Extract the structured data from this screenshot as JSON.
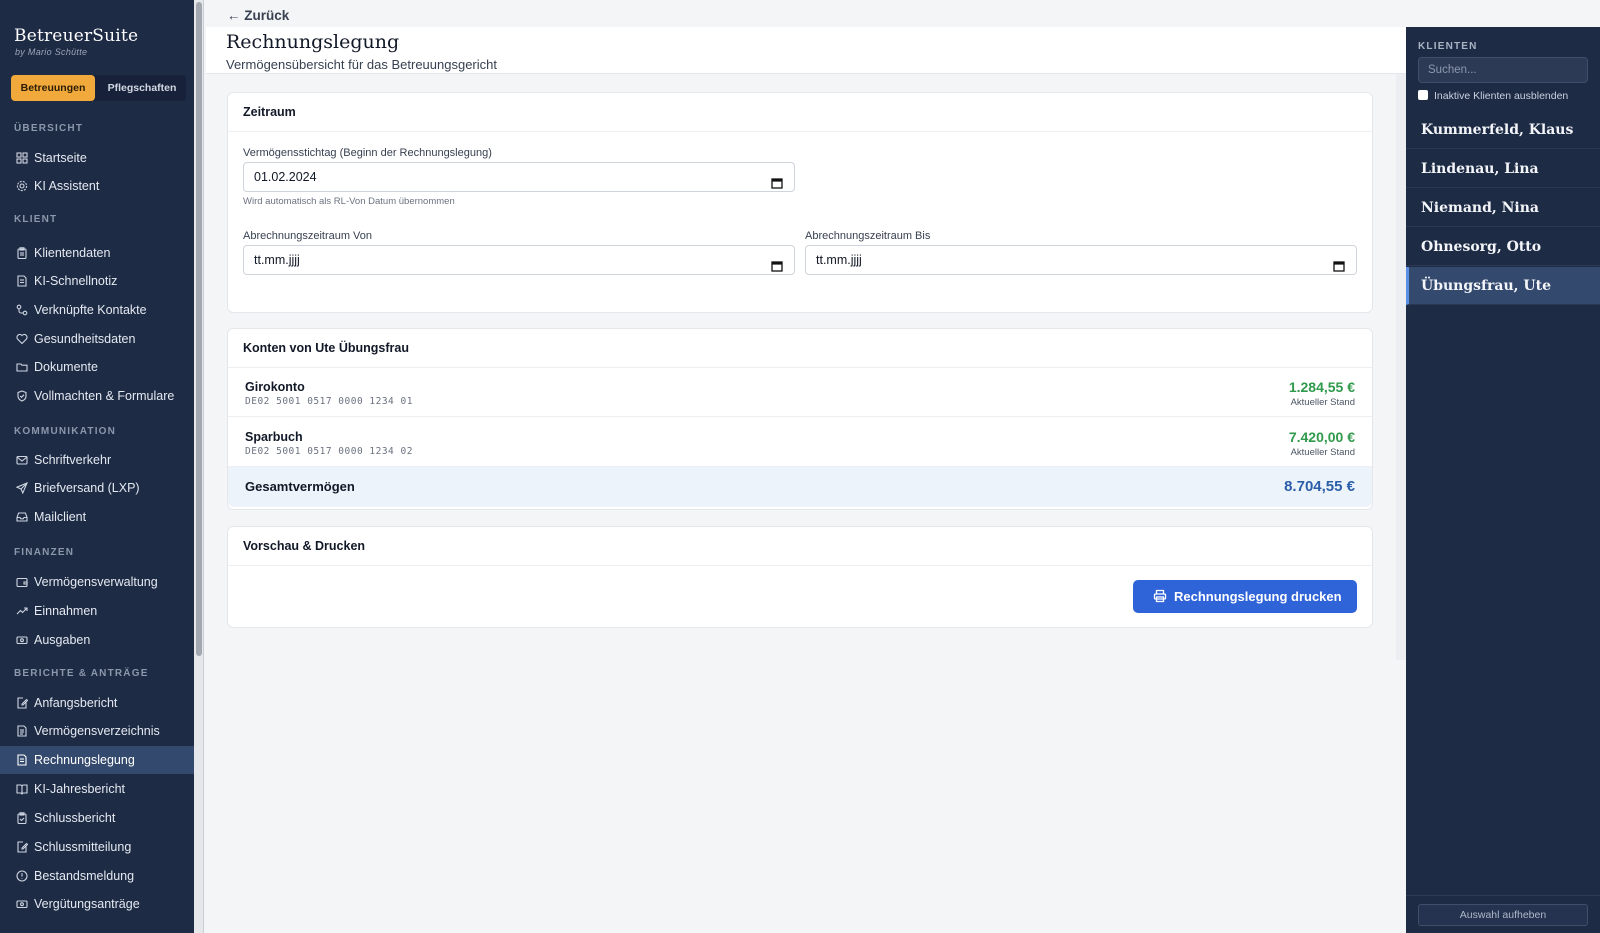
{
  "brand": {
    "name": "BetreuerSuite",
    "by": "by Mario Schütte"
  },
  "modes": {
    "active": "Betreuungen",
    "inactive": "Pflegschaften"
  },
  "nav": {
    "overview_head": "ÜBERSICHT",
    "overview": [
      {
        "label": "Startseite",
        "icon": "grid-icon"
      },
      {
        "label": "KI Assistent",
        "icon": "gear-icon"
      }
    ],
    "client_head": "KLIENT",
    "client": [
      {
        "label": "Klientendaten",
        "icon": "clipboard-icon"
      },
      {
        "label": "KI-Schnellnotiz",
        "icon": "note-icon"
      },
      {
        "label": "Verknüpfte Kontakte",
        "icon": "link-icon"
      },
      {
        "label": "Gesundheitsdaten",
        "icon": "heart-icon"
      },
      {
        "label": "Dokumente",
        "icon": "folder-icon"
      },
      {
        "label": "Vollmachten & Formulare",
        "icon": "shield-icon"
      }
    ],
    "comm_head": "KOMMUNIKATION",
    "comm": [
      {
        "label": "Schriftverkehr",
        "icon": "mail-icon"
      },
      {
        "label": "Briefversand (LXP)",
        "icon": "send-icon"
      },
      {
        "label": "Mailclient",
        "icon": "inbox-icon"
      }
    ],
    "fin_head": "FINANZEN",
    "fin": [
      {
        "label": "Vermögensverwaltung",
        "icon": "wallet-icon"
      },
      {
        "label": "Einnahmen",
        "icon": "trend-up-icon"
      },
      {
        "label": "Ausgaben",
        "icon": "banknote-icon"
      }
    ],
    "reports_head": "BERICHTE & ANTRÄGE",
    "reports": [
      {
        "label": "Anfangsbericht",
        "icon": "edit-doc-icon"
      },
      {
        "label": "Vermögensverzeichnis",
        "icon": "list-doc-icon"
      },
      {
        "label": "Rechnungslegung",
        "icon": "doc-icon",
        "active": true
      },
      {
        "label": "KI-Jahresbericht",
        "icon": "book-icon"
      },
      {
        "label": "Schlussbericht",
        "icon": "check-clipboard-icon"
      },
      {
        "label": "Schlussmitteilung",
        "icon": "edit-doc-icon"
      },
      {
        "label": "Bestandsmeldung",
        "icon": "alert-circle-icon"
      },
      {
        "label": "Vergütungsanträge",
        "icon": "banknote-icon"
      }
    ]
  },
  "header": {
    "back": "← Zurück",
    "title": "Rechnungslegung",
    "subtitle": "Vermögensübersicht für das Betreuungsgericht"
  },
  "zeitraum": {
    "title": "Zeitraum",
    "stichtag_label": "Vermögensstichtag (Beginn der Rechnungslegung)",
    "stichtag_value": "01.02.2024",
    "stichtag_hint": "Wird automatisch als RL-Von Datum übernommen",
    "von_label": "Abrechnungszeitraum Von",
    "von_value": "tt.mm.jjjj",
    "bis_label": "Abrechnungszeitraum Bis",
    "bis_value": "tt.mm.jjjj"
  },
  "konten": {
    "title": "Konten von Ute Übungsfrau",
    "accounts": [
      {
        "name": "Girokonto",
        "iban": "DE02 5001 0517 0000 1234 01",
        "amount": "1.284,55 €",
        "stand": "Aktueller Stand"
      },
      {
        "name": "Sparbuch",
        "iban": "DE02 5001 0517 0000 1234 02",
        "amount": "7.420,00 €",
        "stand": "Aktueller Stand"
      }
    ],
    "total_label": "Gesamtvermögen",
    "total_amount": "8.704,55 €"
  },
  "print": {
    "title": "Vorschau & Drucken",
    "button": "Rechnungslegung drucken"
  },
  "clients": {
    "title": "KLIENTEN",
    "search_placeholder": "Suchen...",
    "inactive_toggle": "Inaktive Klienten ausblenden",
    "list": [
      "Kummerfeld, Klaus",
      "Lindenau, Lina",
      "Niemand, Nina",
      "Ohnesorg, Otto",
      "Übungsfrau, Ute"
    ],
    "selected": "Übungsfrau, Ute",
    "clear": "Auswahl aufheben"
  },
  "colors": {
    "sidebar": "#1e2b45",
    "accent_orange": "#f2a93b",
    "primary_blue": "#2f63d8",
    "amount_green": "#2f9a4c",
    "total_blue": "#2b5ea8"
  }
}
